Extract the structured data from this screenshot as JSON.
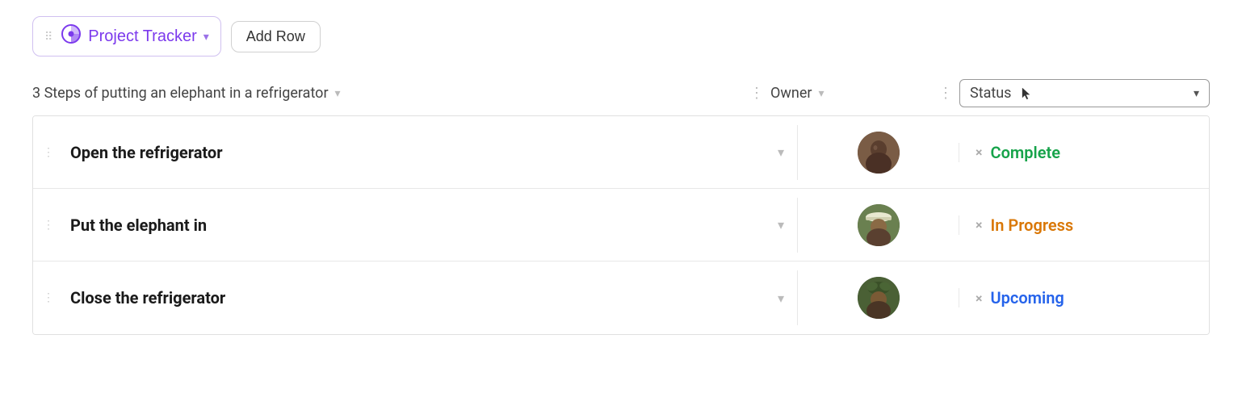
{
  "toolbar": {
    "project_tracker_label": "Project Tracker",
    "add_row_label": "Add Row",
    "tracker_icon": "◎"
  },
  "columns": {
    "task_label": "3 Steps of putting an elephant in a refrigerator",
    "owner_label": "Owner",
    "status_label": "Status"
  },
  "rows": [
    {
      "id": 1,
      "task": "Open the refrigerator",
      "status": "Complete",
      "status_class": "status-complete",
      "avatar_class": "avatar-1"
    },
    {
      "id": 2,
      "task": "Put the elephant in",
      "status": "In Progress",
      "status_class": "status-in-progress",
      "avatar_class": "avatar-2"
    },
    {
      "id": 3,
      "task": "Close the refrigerator",
      "status": "Upcoming",
      "status_class": "status-upcoming",
      "avatar_class": "avatar-3"
    }
  ],
  "icons": {
    "drag_handle": "⠿",
    "chevron_down": "∨",
    "dots": "⋮",
    "close_x": "×"
  }
}
